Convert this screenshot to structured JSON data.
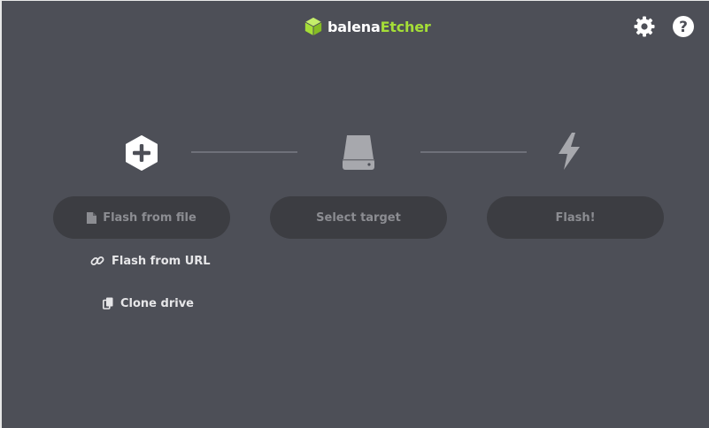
{
  "header": {
    "brand_part1": "balena",
    "brand_part2": "Etcher",
    "brand_color": "#a5de37",
    "icons": [
      "settings-gear-icon",
      "help-question-icon"
    ]
  },
  "steps": [
    {
      "icon": "plus-hexagon-icon",
      "button_label": "Flash from file",
      "button_icon": "file-icon"
    },
    {
      "icon": "drive-icon",
      "button_label": "Select target"
    },
    {
      "icon": "lightning-icon",
      "button_label": "Flash!"
    }
  ],
  "source_options": [
    {
      "label": "Flash from URL",
      "icon": "link-icon"
    },
    {
      "label": "Clone drive",
      "icon": "copy-icon"
    }
  ]
}
